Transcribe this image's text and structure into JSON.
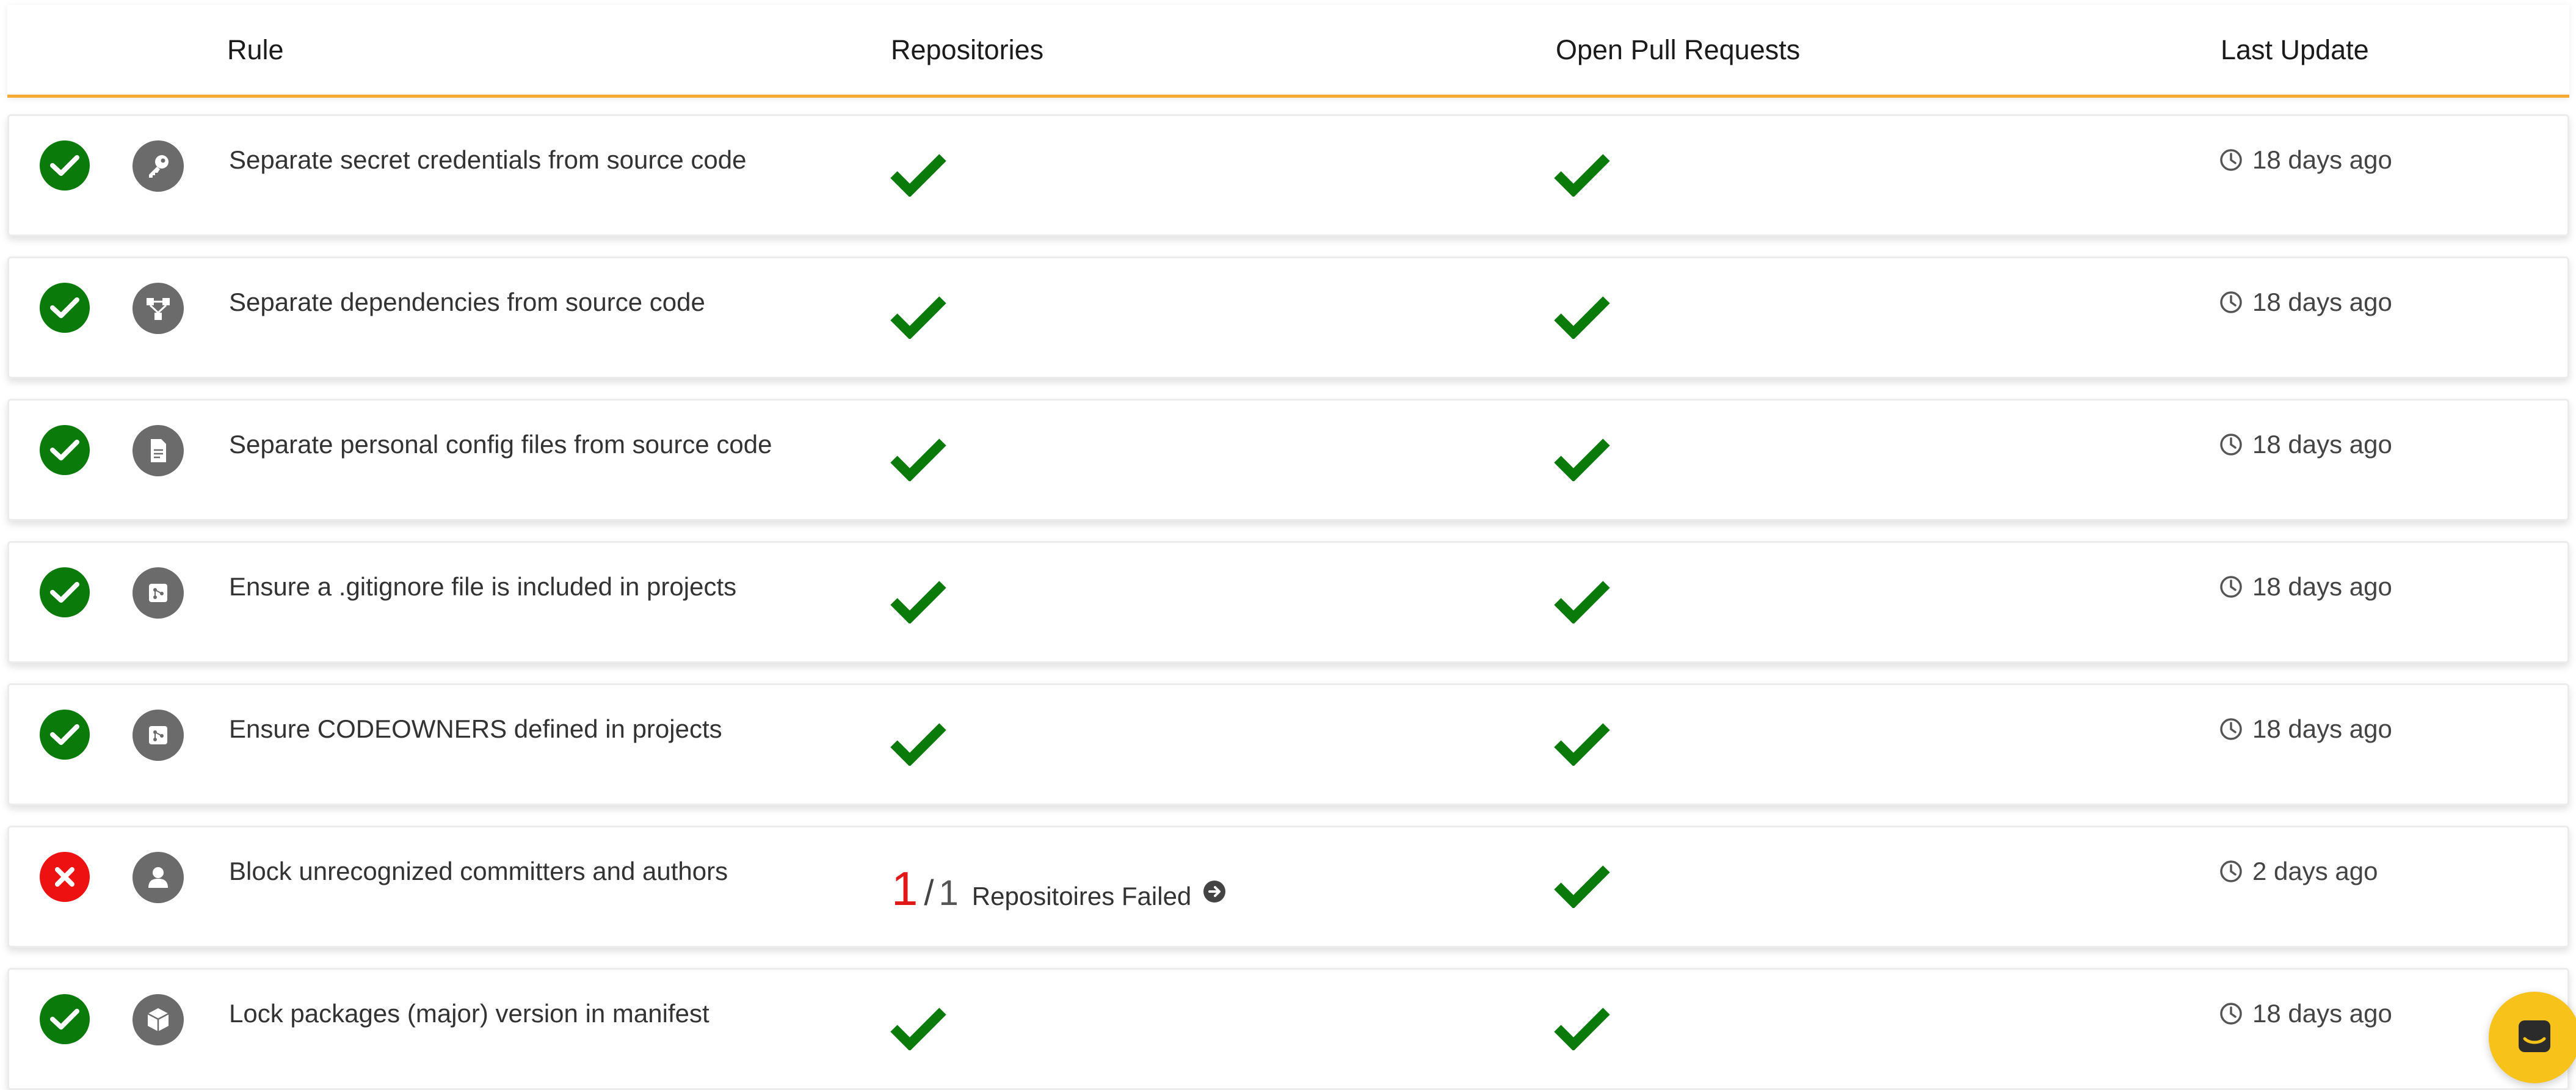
{
  "columns": {
    "rule": "Rule",
    "repositories": "Repositories",
    "open_pull_requests": "Open Pull Requests",
    "last_update": "Last Update"
  },
  "rows": [
    {
      "status": "pass",
      "category_icon": "key-icon",
      "rule": "Separate secret credentials from source code",
      "repositories": "pass",
      "open_pull_requests": "pass",
      "last_update": "18 days ago"
    },
    {
      "status": "pass",
      "category_icon": "dependency-icon",
      "rule": "Separate dependencies from source code",
      "repositories": "pass",
      "open_pull_requests": "pass",
      "last_update": "18 days ago"
    },
    {
      "status": "pass",
      "category_icon": "file-icon",
      "rule": "Separate personal config files from source code",
      "repositories": "pass",
      "open_pull_requests": "pass",
      "last_update": "18 days ago"
    },
    {
      "status": "pass",
      "category_icon": "git-icon",
      "rule": "Ensure a .gitignore file is included in projects",
      "repositories": "pass",
      "open_pull_requests": "pass",
      "last_update": "18 days ago"
    },
    {
      "status": "pass",
      "category_icon": "git-icon",
      "rule": "Ensure CODEOWNERS defined in projects",
      "repositories": "pass",
      "open_pull_requests": "pass",
      "last_update": "18 days ago"
    },
    {
      "status": "fail",
      "category_icon": "user-icon",
      "rule": "Block unrecognized committers and authors",
      "repositories_failed": {
        "failed": "1",
        "separator": "/",
        "total": "1",
        "label": "Repositoires Failed"
      },
      "open_pull_requests": "pass",
      "last_update": "2 days ago"
    },
    {
      "status": "pass",
      "category_icon": "package-icon",
      "rule": "Lock packages (major) version in manifest",
      "repositories": "pass",
      "open_pull_requests": "pass",
      "last_update": "18 days ago"
    }
  ],
  "colors": {
    "pass": "#0a7a0a",
    "fail": "#ee1111",
    "accent": "#f7a935",
    "chat": "#f7c21a"
  },
  "chat_button_icon": "chat-icon"
}
